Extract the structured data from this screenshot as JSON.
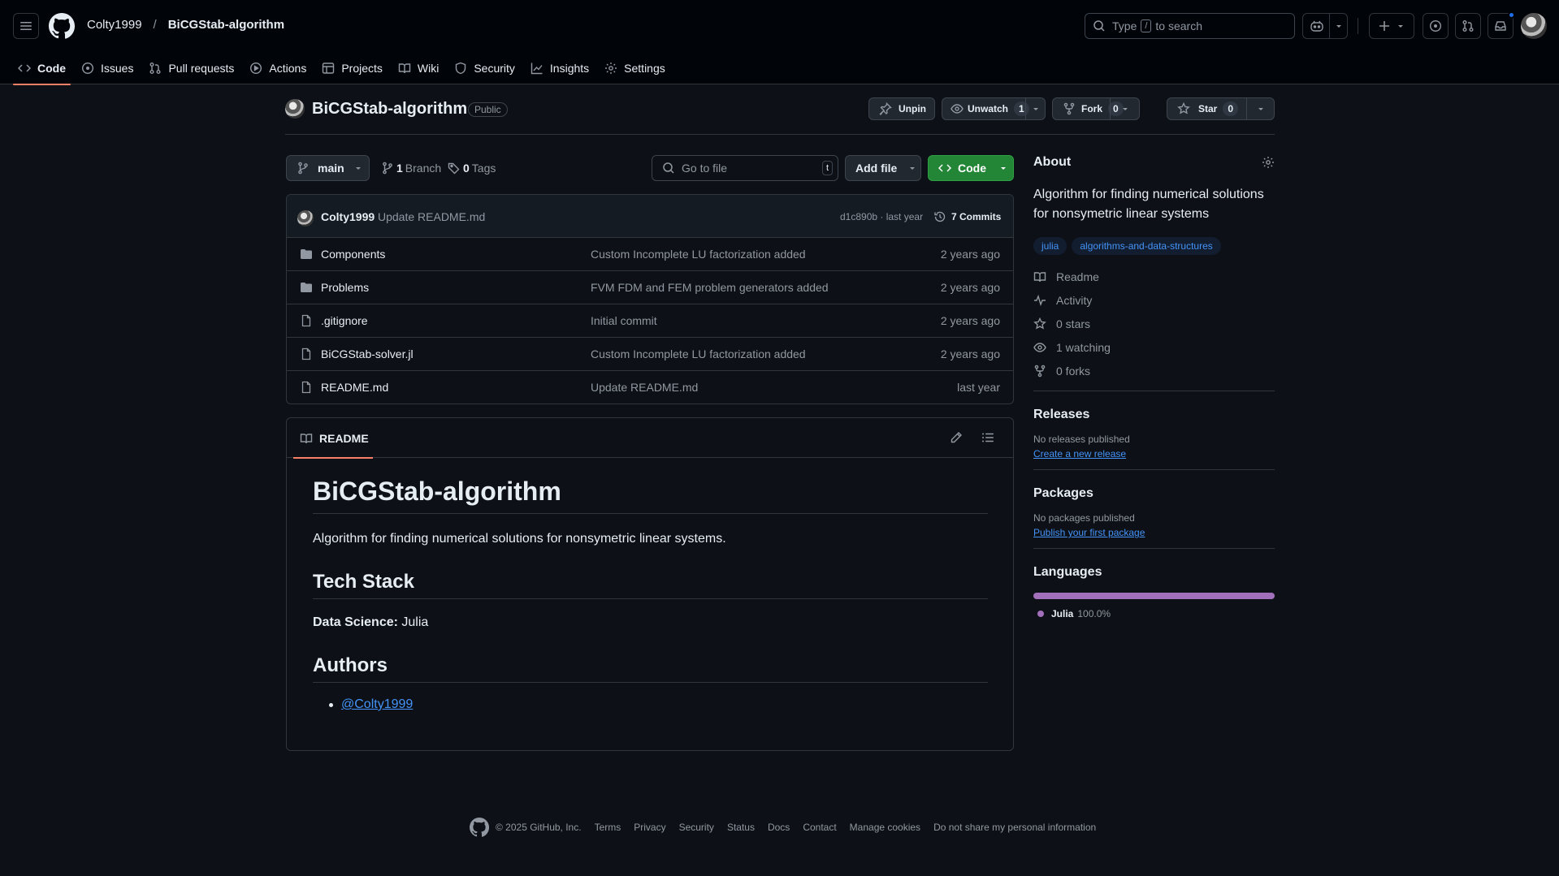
{
  "header": {
    "owner": "Colty1999",
    "separator": "/",
    "repo": "BiCGStab-algorithm",
    "search_prefix": "Type",
    "search_key": "/",
    "search_suffix": "to search"
  },
  "nav": [
    {
      "label": "Code",
      "icon": "code-icon",
      "active": true
    },
    {
      "label": "Issues",
      "icon": "issue-icon"
    },
    {
      "label": "Pull requests",
      "icon": "pull-request-icon"
    },
    {
      "label": "Actions",
      "icon": "actions-icon"
    },
    {
      "label": "Projects",
      "icon": "projects-icon"
    },
    {
      "label": "Wiki",
      "icon": "wiki-icon"
    },
    {
      "label": "Security",
      "icon": "shield-icon"
    },
    {
      "label": "Insights",
      "icon": "graph-icon"
    },
    {
      "label": "Settings",
      "icon": "gear-icon"
    }
  ],
  "repo_title": {
    "name": "BiCGStab-algorithm",
    "visibility": "Public",
    "unpin": "Unpin",
    "unwatch": "Unwatch",
    "watch_count": "1",
    "fork": "Fork",
    "fork_count": "0",
    "star": "Star",
    "star_count": "0"
  },
  "controls": {
    "branch": "main",
    "branches_count": "1",
    "branches_label": "Branch",
    "tags_count": "0",
    "tags_label": "Tags",
    "go_to_file": "Go to file",
    "go_to_file_key": "t",
    "add_file": "Add file",
    "code": "Code"
  },
  "latest_commit": {
    "author": "Colty1999",
    "message": "Update README.md",
    "hash_age": "d1c890b · last year",
    "commits": "7 Commits"
  },
  "files": [
    {
      "name": "Components",
      "type": "folder",
      "message": "Custom Incomplete LU factorization added",
      "age": "2 years ago"
    },
    {
      "name": "Problems",
      "type": "folder",
      "message": "FVM FDM and FEM problem generators added",
      "age": "2 years ago"
    },
    {
      "name": ".gitignore",
      "type": "file",
      "message": "Initial commit",
      "age": "2 years ago"
    },
    {
      "name": "BiCGStab-solver.jl",
      "type": "file",
      "message": "Custom Incomplete LU factorization added",
      "age": "2 years ago"
    },
    {
      "name": "README.md",
      "type": "file",
      "message": "Update README.md",
      "age": "last year"
    }
  ],
  "readme": {
    "tab": "README",
    "h1": "BiCGStab-algorithm",
    "intro": "Algorithm for finding numerical solutions for nonsymetric linear systems.",
    "h2_stack": "Tech Stack",
    "stack_label": "Data Science:",
    "stack_value": "Julia",
    "h2_authors": "Authors",
    "author_link": "@Colty1999"
  },
  "sidebar": {
    "about_title": "About",
    "description": "Algorithm for finding numerical solutions for nonsymetric linear systems",
    "topics": [
      "julia",
      "algorithms-and-data-structures"
    ],
    "links": [
      {
        "label": "Readme",
        "icon": "book-icon"
      },
      {
        "label": "Activity",
        "icon": "pulse-icon"
      },
      {
        "label": "0 stars",
        "icon": "star-icon"
      },
      {
        "label": "1 watching",
        "icon": "eye-icon"
      },
      {
        "label": "0 forks",
        "icon": "fork-icon"
      }
    ],
    "releases_title": "Releases",
    "releases_none": "No releases published",
    "releases_link": "Create a new release",
    "packages_title": "Packages",
    "packages_none": "No packages published",
    "packages_link": "Publish your first package",
    "languages_title": "Languages",
    "language_name": "Julia",
    "language_percent": "100.0%",
    "language_color": "#a270ba"
  },
  "footer": {
    "copyright": "© 2025 GitHub, Inc.",
    "links": [
      "Terms",
      "Privacy",
      "Security",
      "Status",
      "Docs",
      "Contact",
      "Manage cookies",
      "Do not share my personal information"
    ]
  },
  "colors": {
    "accent_green": "#238636",
    "link_blue": "#4493f8",
    "tab_underline": "#f78166"
  }
}
